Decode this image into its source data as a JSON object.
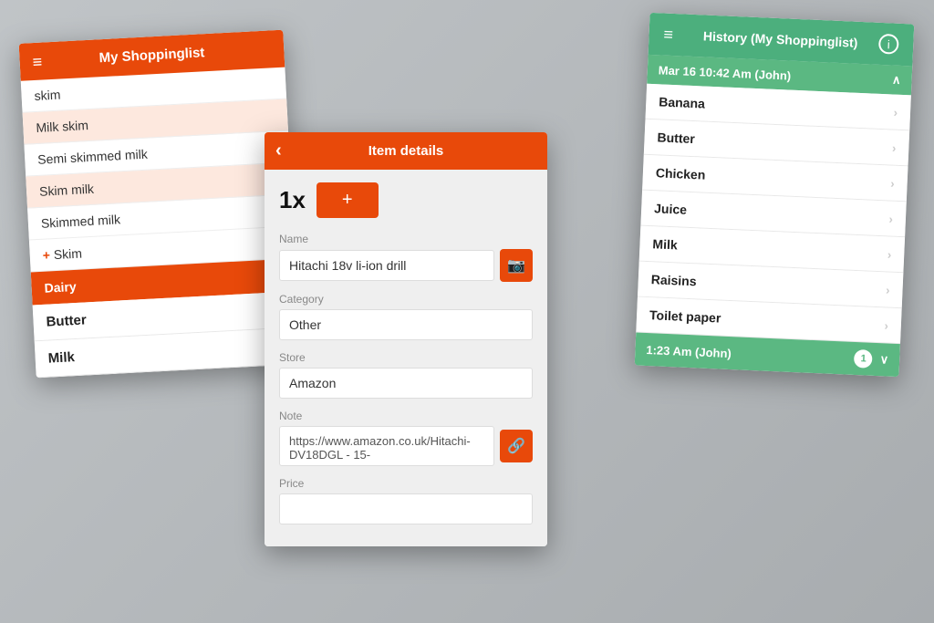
{
  "shopping_card": {
    "header": {
      "menu_icon": "≡",
      "title": "My Shoppinglist"
    },
    "search_rows": [
      {
        "text": "skim",
        "highlighted": false
      },
      {
        "text": "Milk skim",
        "highlighted": true
      },
      {
        "text": "Semi skimmed milk",
        "highlighted": false
      },
      {
        "text": "Skim milk",
        "highlighted": true
      },
      {
        "text": "Skimmed milk",
        "highlighted": false
      },
      {
        "text": "+ Skim",
        "highlighted": false,
        "add": true
      }
    ],
    "section": {
      "label": "Dairy",
      "chevron": "∧"
    },
    "items": [
      {
        "name": "Butter",
        "chevron": "›"
      },
      {
        "name": "Milk",
        "chevron": "›"
      }
    ]
  },
  "details_card": {
    "header": {
      "back_icon": "‹",
      "title": "Item details"
    },
    "quantity": {
      "value": "1x",
      "plus_label": "+"
    },
    "fields": {
      "name_label": "Name",
      "name_value": "Hitachi 18v li-ion drill",
      "camera_icon": "📷",
      "category_label": "Category",
      "category_value": "Other",
      "store_label": "Store",
      "store_value": "Amazon",
      "note_label": "Note",
      "note_value": "https://www.amazon.co.uk/Hitachi-DV18DGL - 15-",
      "link_icon": "🔗",
      "price_label": "Price",
      "price_value": ""
    }
  },
  "history_card": {
    "header": {
      "menu_icon": "≡",
      "title": "History (My Shoppinglist)",
      "info_icon": "i"
    },
    "section": {
      "label": "Mar 16 10:42 Am (John)",
      "chevron": "∧"
    },
    "items": [
      {
        "name": "Banana",
        "chevron": "›"
      },
      {
        "name": "Butter",
        "chevron": "›"
      },
      {
        "name": "Chicken",
        "chevron": "›"
      },
      {
        "name": "Juice",
        "chevron": "›"
      },
      {
        "name": "Milk",
        "chevron": "›"
      },
      {
        "name": "Raisins",
        "chevron": "›"
      },
      {
        "name": "Toilet paper",
        "chevron": "›"
      }
    ],
    "footer": {
      "label": "1:23 Am (John)",
      "badge": "1",
      "chevron": "∨"
    }
  },
  "colors": {
    "orange": "#e8490a",
    "green": "#4caf7d",
    "green_light": "#5bb882"
  }
}
